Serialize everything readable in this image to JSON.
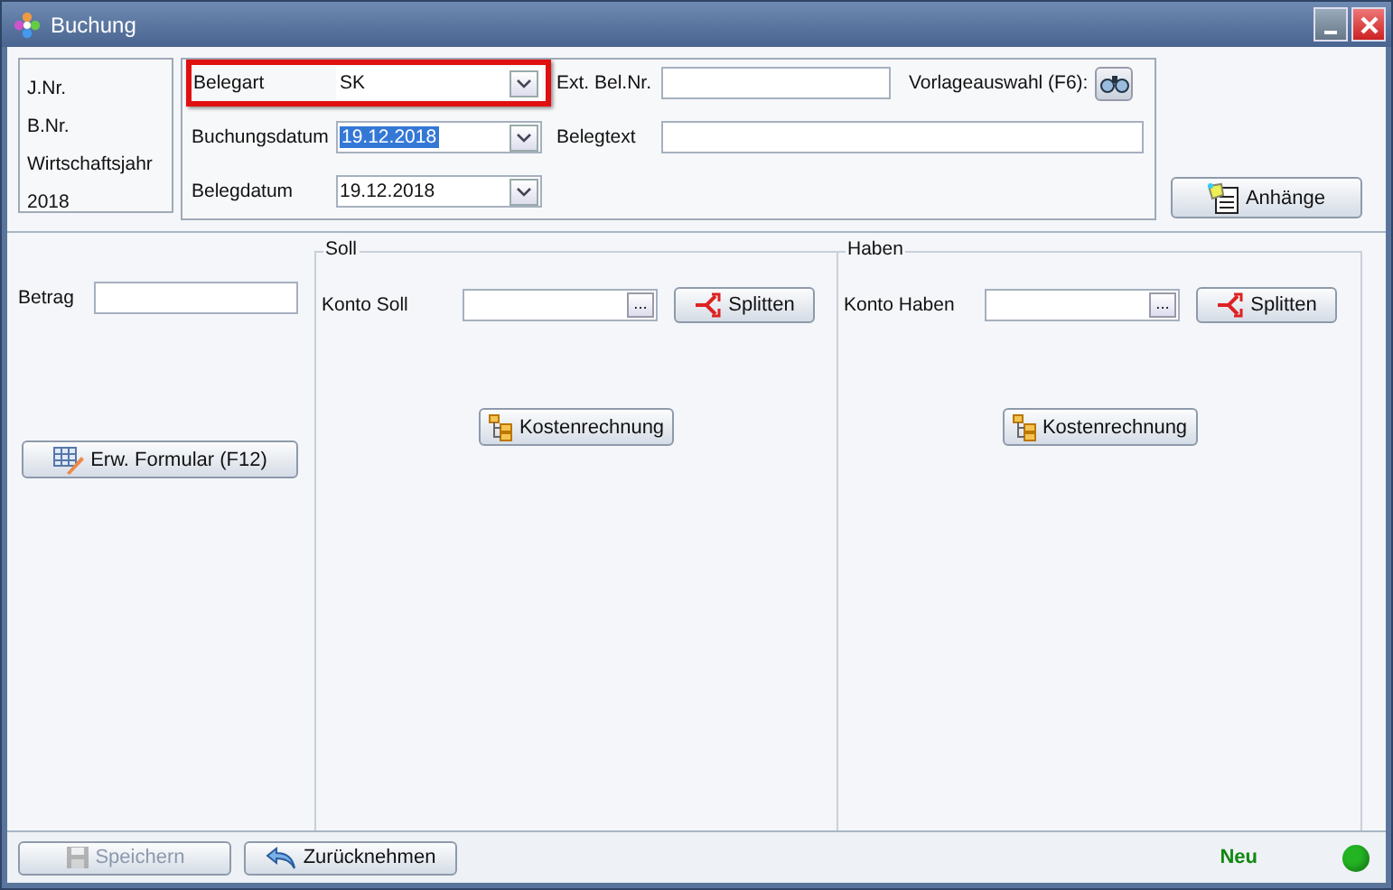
{
  "window": {
    "title": "Buchung"
  },
  "info": [
    "J.Nr.",
    "B.Nr.",
    "Wirtschaftsjahr",
    "2018"
  ],
  "header": {
    "belegart": {
      "label": "Belegart",
      "value": "SK",
      "highlighted": true
    },
    "buchungsdatum": {
      "label": "Buchungsdatum",
      "value": "19.12.2018",
      "text_selected": true
    },
    "belegdatum": {
      "label": "Belegdatum",
      "value": "19.12.2018",
      "text_selected": false
    },
    "ext_bel_nr": {
      "label": "Ext. Bel.Nr."
    },
    "belegtext": {
      "label": "Belegtext"
    },
    "vorlage": {
      "label": "Vorlageauswahl (F6):"
    }
  },
  "attachments_button": "Anhänge",
  "betrag": {
    "label": "Betrag"
  },
  "extended_form_button": "Erw. Formular (F12)",
  "groups": [
    {
      "title": "Soll",
      "account_label": "Konto Soll",
      "browse": "...",
      "split_button": "Splitten",
      "cost_button": "Kostenrechnung"
    },
    {
      "title": "Haben",
      "account_label": "Konto Haben",
      "browse": "...",
      "split_button": "Splitten",
      "cost_button": "Kostenrechnung"
    }
  ],
  "footer": {
    "buttons": [
      {
        "label": "Speichern",
        "kind": "save",
        "disabled": true
      },
      {
        "label": "Zurücknehmen",
        "kind": "undo",
        "disabled": false
      }
    ],
    "status": {
      "label": "Neu",
      "kind": "ok"
    }
  }
}
